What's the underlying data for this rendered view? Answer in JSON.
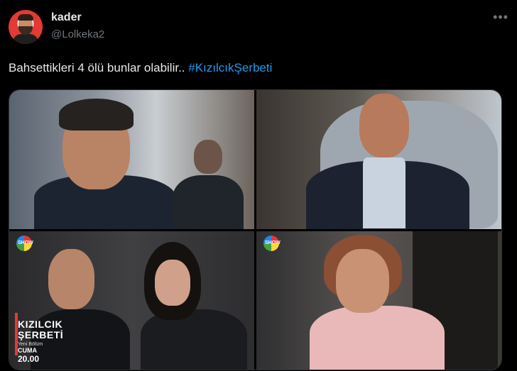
{
  "author": {
    "name": "kader",
    "handle": "@Lolkeka2"
  },
  "tweet": {
    "text": "Bahsettikleri 4 ölü bunlar olabilir.. ",
    "hashtag": "#KızılcıkŞerbeti"
  },
  "media": {
    "count": 4,
    "image3_overlay": {
      "channel": "SHOW",
      "title_line1": "KIZILCIK",
      "title_line2": "ŞERBETİ",
      "sub": "Yeni Bölüm",
      "day": "CUMA",
      "time": "20.00"
    },
    "image4_overlay": {
      "channel": "SHOW"
    }
  },
  "colors": {
    "background": "#000000",
    "text": "#e7e9ea",
    "muted": "#71767b",
    "link": "#1d9bf0",
    "border": "#2f3336"
  },
  "icons": {
    "more": "more-horizontal-icon"
  }
}
